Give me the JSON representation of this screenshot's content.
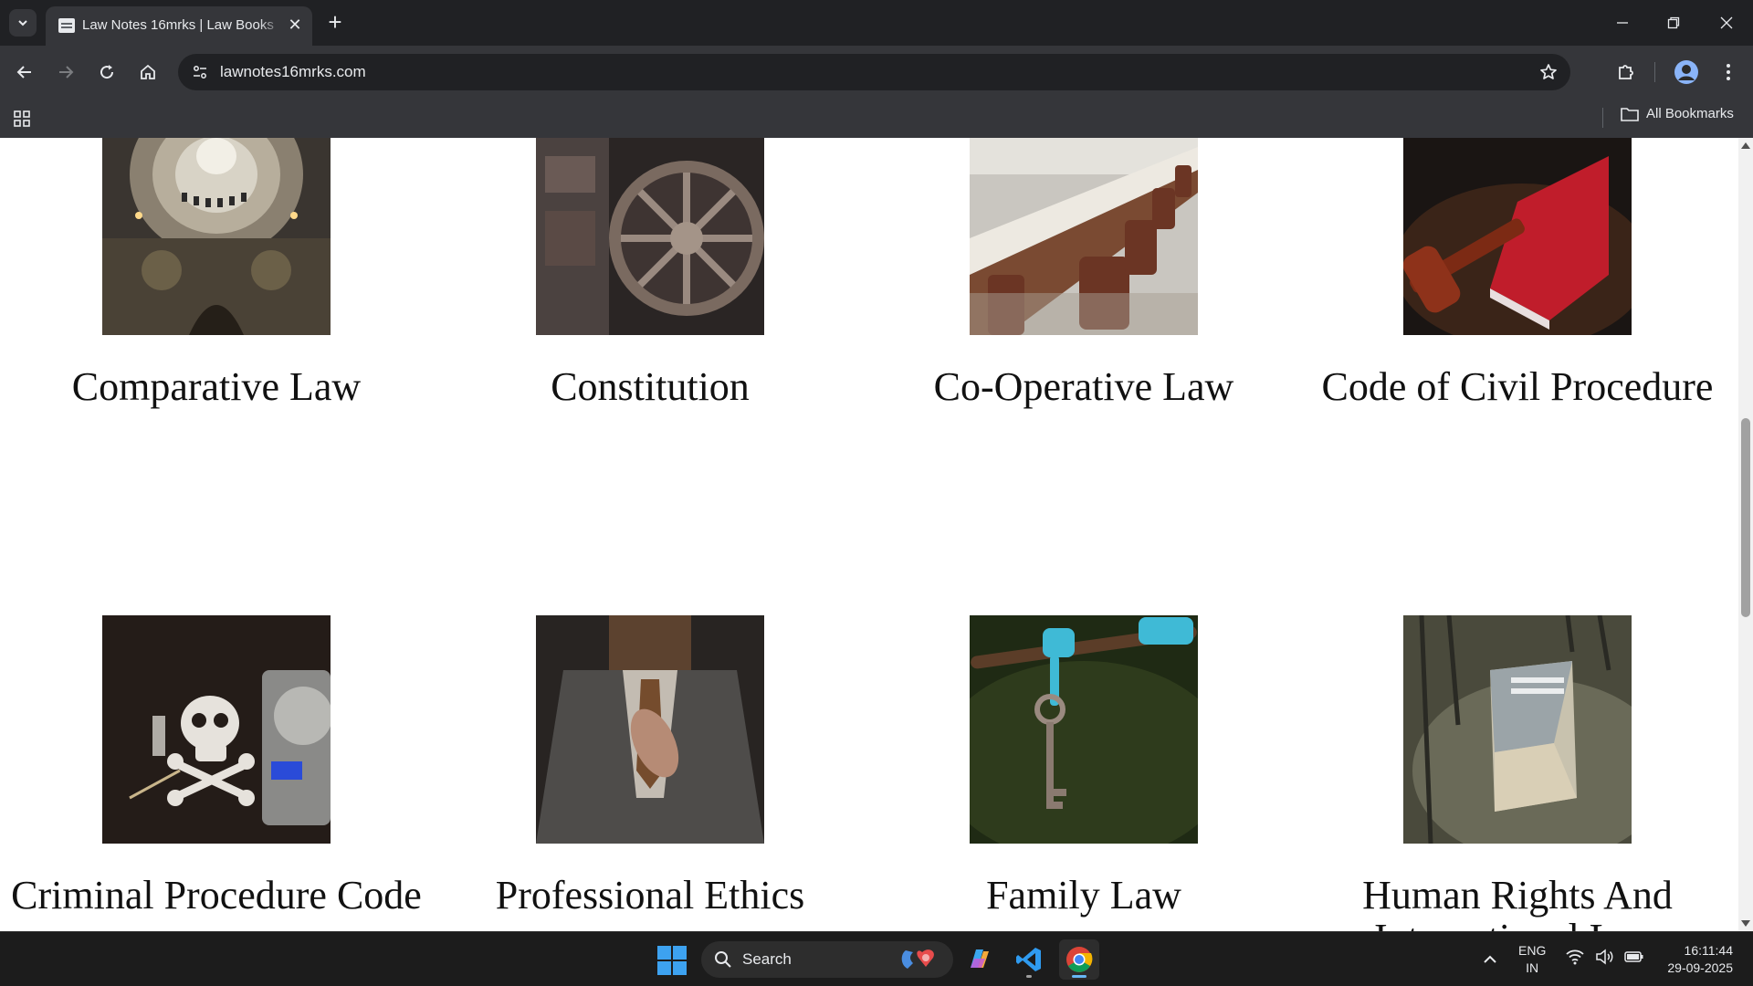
{
  "browser": {
    "tab": {
      "title": "Law Notes 16mrks | Law Books",
      "close_icon": "close-icon"
    },
    "address_bar": {
      "url": "lawnotes16mrks.com"
    },
    "bookmarks": {
      "all_bookmarks_label": "All Bookmarks"
    }
  },
  "cards": [
    {
      "title": "Comparative Law",
      "image": "dome-interior-photo"
    },
    {
      "title": "Constitution",
      "image": "stone-wheel-photo"
    },
    {
      "title": "Co-Operative Law",
      "image": "boardroom-chairs-photo"
    },
    {
      "title": "Code of Civil Procedure",
      "image": "gavel-red-book-photo"
    },
    {
      "title": "Criminal Procedure Code",
      "image": "skull-scale-photo"
    },
    {
      "title": "Professional Ethics",
      "image": "suited-man-photo"
    },
    {
      "title": "Family Law",
      "image": "hanging-key-photo"
    },
    {
      "title": "Human Rights And International Law",
      "image": "human-rights-book-photo"
    }
  ],
  "taskbar": {
    "search_label": "Search",
    "language": {
      "line1": "ENG",
      "line2": "IN"
    },
    "clock": {
      "time": "16:11:44",
      "date": "29-09-2025"
    }
  },
  "colors": {
    "chrome_dark": "#202124",
    "chrome_toolbar": "#35363a",
    "taskbar": "#1c1c1c",
    "windows_blue": "#3da2f0"
  }
}
